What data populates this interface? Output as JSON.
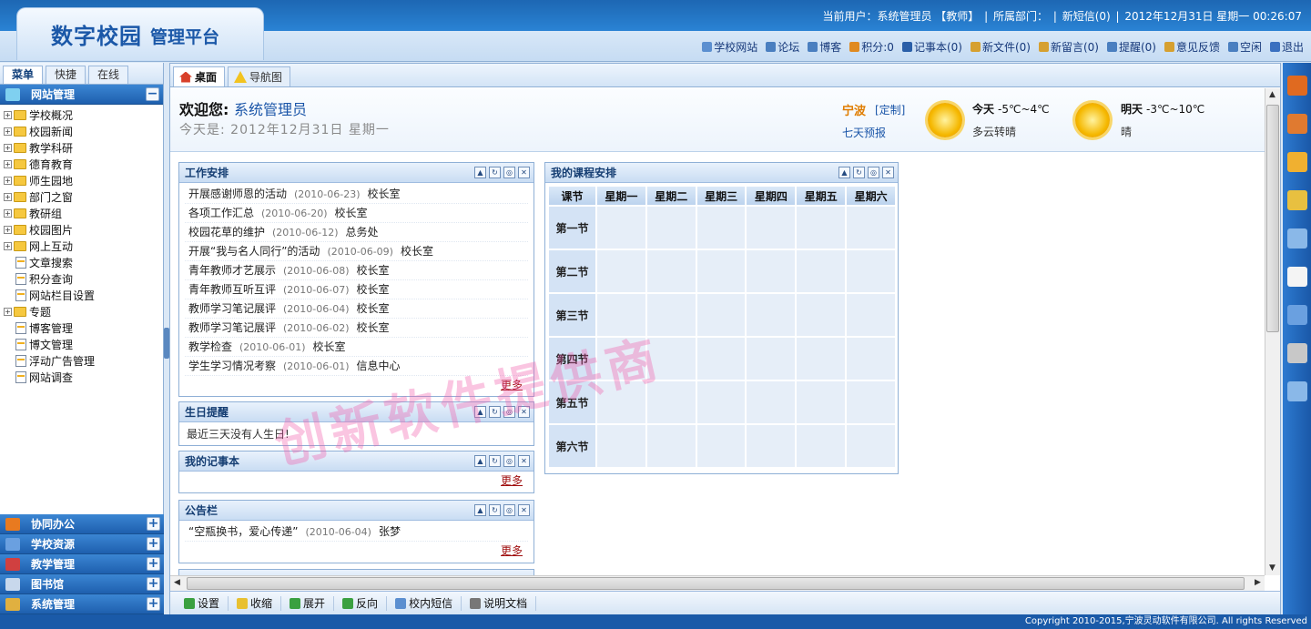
{
  "header": {
    "title": "数字校园",
    "subtitle": "管理平台",
    "current_user": "当前用户：系统管理员 【教师】",
    "department": "所属部门：",
    "sms": "新短信(0)",
    "datetime": "2012年12月31日 星期一 00:26:07"
  },
  "toolbar": [
    {
      "label": "学校网站",
      "icon": "website-icon",
      "color": "#5b8fd0"
    },
    {
      "label": "论坛",
      "icon": "forum-icon",
      "color": "#4a7fc0"
    },
    {
      "label": "博客",
      "icon": "blog-icon",
      "color": "#4a7fc0"
    },
    {
      "label": "积分:0",
      "icon": "score-icon",
      "color": "#e08a20"
    },
    {
      "label": "记事本(0)",
      "icon": "notepad-icon",
      "color": "#2a5fa8"
    },
    {
      "label": "新文件(0)",
      "icon": "file-icon",
      "color": "#d6a030"
    },
    {
      "label": "新留言(0)",
      "icon": "message-icon",
      "color": "#d6a030"
    },
    {
      "label": "提醒(0)",
      "icon": "reminder-icon",
      "color": "#4a7fc0"
    },
    {
      "label": "意见反馈",
      "icon": "feedback-icon",
      "color": "#d6a030"
    },
    {
      "label": "空闲",
      "icon": "status-icon",
      "color": "#4a7fc0"
    },
    {
      "label": "退出",
      "icon": "logout-icon",
      "color": "#3a70c0"
    }
  ],
  "left_tabs": [
    "菜单",
    "快捷",
    "在线"
  ],
  "menu_section": {
    "label": "网站管理",
    "toggle": "−"
  },
  "tree": [
    {
      "label": "学校概况",
      "type": "folder"
    },
    {
      "label": "校园新闻",
      "type": "folder"
    },
    {
      "label": "教学科研",
      "type": "folder"
    },
    {
      "label": "德育教育",
      "type": "folder"
    },
    {
      "label": "师生园地",
      "type": "folder"
    },
    {
      "label": "部门之窗",
      "type": "folder"
    },
    {
      "label": "教研组",
      "type": "folder"
    },
    {
      "label": "校园图片",
      "type": "folder"
    },
    {
      "label": "网上互动",
      "type": "folder"
    },
    {
      "label": "文章搜索",
      "type": "page"
    },
    {
      "label": "积分查询",
      "type": "page"
    },
    {
      "label": "网站栏目设置",
      "type": "page"
    },
    {
      "label": "专题",
      "type": "folder"
    },
    {
      "label": "博客管理",
      "type": "page"
    },
    {
      "label": "博文管理",
      "type": "page"
    },
    {
      "label": "浮动广告管理",
      "type": "page"
    },
    {
      "label": "网站调查",
      "type": "page"
    }
  ],
  "bottom_sections": [
    {
      "label": "协同办公",
      "toggle": "+",
      "color": "#e87a20"
    },
    {
      "label": "学校资源",
      "toggle": "+",
      "color": "#6aa0e0"
    },
    {
      "label": "教学管理",
      "toggle": "+",
      "color": "#d04040"
    },
    {
      "label": "图书馆",
      "toggle": "+",
      "color": "#c8d8ec"
    },
    {
      "label": "系统管理",
      "toggle": "+",
      "color": "#e0b040"
    }
  ],
  "main_tabs": [
    "桌面",
    "导航图"
  ],
  "welcome": {
    "greeting": "欢迎您:",
    "user": "系统管理员",
    "today": "今天是: 2012年12月31日 星期一"
  },
  "weather": {
    "city": "宁波",
    "customize": "[定制]",
    "forecast7": "七天预报",
    "today_label": "今天",
    "today_temp": "-5℃~4℃",
    "today_desc": "多云转晴",
    "tomorrow_label": "明天",
    "tomorrow_temp": "-3℃~10℃",
    "tomorrow_desc": "晴"
  },
  "work": {
    "title": "工作安排",
    "more": "更多",
    "items": [
      {
        "title": "开展感谢师恩的活动",
        "date": "(2010-06-23)",
        "dept": "校长室"
      },
      {
        "title": "各项工作汇总",
        "date": "(2010-06-20)",
        "dept": "校长室"
      },
      {
        "title": "校园花草的维护",
        "date": "(2010-06-12)",
        "dept": "总务处"
      },
      {
        "title": "开展“我与名人同行”的活动",
        "date": "(2010-06-09)",
        "dept": "校长室"
      },
      {
        "title": "青年教师才艺展示",
        "date": "(2010-06-08)",
        "dept": "校长室"
      },
      {
        "title": "青年教师互听互评",
        "date": "(2010-06-07)",
        "dept": "校长室"
      },
      {
        "title": "教师学习笔记展评",
        "date": "(2010-06-04)",
        "dept": "校长室"
      },
      {
        "title": "教师学习笔记展评",
        "date": "(2010-06-02)",
        "dept": "校长室"
      },
      {
        "title": "教学检查",
        "date": "(2010-06-01)",
        "dept": "校长室"
      },
      {
        "title": "学生学习情况考察",
        "date": "(2010-06-01)",
        "dept": "信息中心"
      }
    ]
  },
  "birthday": {
    "title": "生日提醒",
    "text": "最近三天没有人生日!"
  },
  "notebook": {
    "title": "我的记事本",
    "more": "更多"
  },
  "notice": {
    "title": "公告栏",
    "more": "更多",
    "items": [
      {
        "title": "“空瓶换书，爱心传递”",
        "date": "(2010-06-04)",
        "dept": "张梦"
      }
    ]
  },
  "course": {
    "title": "我的课程安排",
    "headers": [
      "课节",
      "星期一",
      "星期二",
      "星期三",
      "星期四",
      "星期五",
      "星期六"
    ],
    "rows": [
      "第一节",
      "第二节",
      "第三节",
      "第四节",
      "第五节",
      "第六节"
    ]
  },
  "bottom_toolbar": [
    {
      "label": "设置",
      "icon": "settings-icon",
      "color": "#3aa040"
    },
    {
      "label": "收缩",
      "icon": "collapse-icon",
      "color": "#e8c030"
    },
    {
      "label": "展开",
      "icon": "expand-icon",
      "color": "#3aa040"
    },
    {
      "label": "反向",
      "icon": "reverse-icon",
      "color": "#3aa040"
    },
    {
      "label": "校内短信",
      "icon": "sms-icon",
      "color": "#5b8fd0"
    },
    {
      "label": "说明文档",
      "icon": "doc-icon",
      "color": "#777777"
    }
  ],
  "right_icons": [
    {
      "icon": "books-icon",
      "color": "#e06a20"
    },
    {
      "icon": "eraser-icon",
      "color": "#e07a30"
    },
    {
      "icon": "pencil-icon",
      "color": "#f0b030"
    },
    {
      "icon": "key-icon",
      "color": "#e8c040"
    },
    {
      "icon": "user-icon",
      "color": "#8ab8e8"
    },
    {
      "icon": "notes-icon",
      "color": "#f4f4f4"
    },
    {
      "icon": "download-icon",
      "color": "#6aa0e0"
    },
    {
      "icon": "printer-icon",
      "color": "#c8c8c8"
    },
    {
      "icon": "gear-icon",
      "color": "#8ab8e8"
    }
  ],
  "footer": "Copyright 2010-2015,宁波灵动软件有限公司. All rights Reserved",
  "watermark": "创新软件提供商"
}
